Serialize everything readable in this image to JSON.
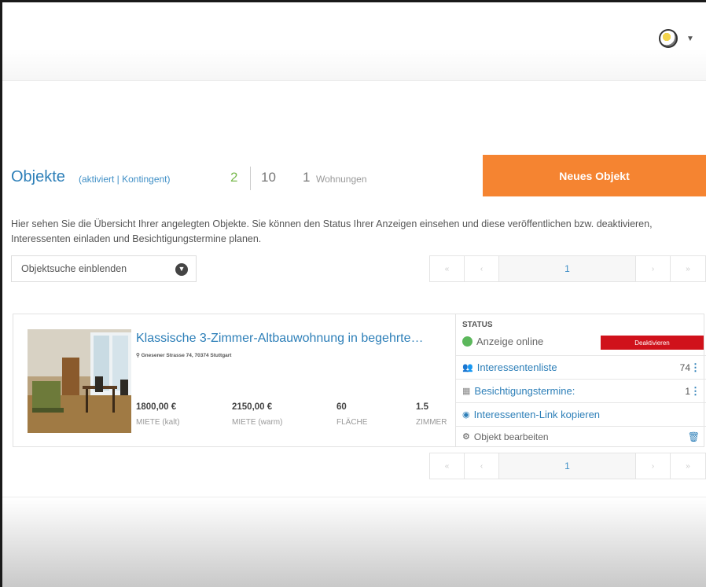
{
  "header": {
    "title": "Objekte",
    "subtitle": "(aktiviert | Kontingent)",
    "active_count": "2",
    "quota": "10",
    "units_count": "1",
    "units_label": "Wohnungen",
    "new_button": "Neues Objekt"
  },
  "description": "Hier sehen Sie die Übersicht Ihrer angelegten Objekte. Sie können den Status Ihrer Anzeigen einsehen und diese veröffentlichen bzw. deaktivieren, Interessenten einladen und Besichtigungstermine planen.",
  "search": {
    "label": "Objektsuche einblenden",
    "icon": "chevron-down-circle-icon"
  },
  "pagination": {
    "first": "«",
    "prev": "‹",
    "page": "1",
    "next": "›",
    "last": "»"
  },
  "listing": {
    "title": "Klassische 3-Zimmer-Altbauwohnung in begehrte…",
    "address": "Gnesener Strasse 74, 70374 Stuttgart",
    "stats": [
      {
        "value": "1800,00 €",
        "label": "MIETE (kalt)"
      },
      {
        "value": "2150,00 €",
        "label": "MIETE (warm)"
      },
      {
        "value": "60",
        "label": "FLÄCHE"
      },
      {
        "value": "1.5",
        "label": "ZIMMER"
      }
    ],
    "status_heading": "STATUS",
    "status_text": "Anzeige online",
    "deactivate_label": "Deaktivieren",
    "actions": {
      "interested_label": "Interessentenliste",
      "interested_count": "74",
      "viewings_label": "Besichtigungstermine:",
      "viewings_count": "1",
      "copy_link_label": "Interessenten-Link kopieren",
      "edit_label": "Objekt bearbeiten"
    }
  },
  "colors": {
    "accent": "#f58431",
    "link": "#2d7fb8",
    "active_count": "#78b94d",
    "online": "#5cb85c",
    "danger": "#d0121b"
  }
}
